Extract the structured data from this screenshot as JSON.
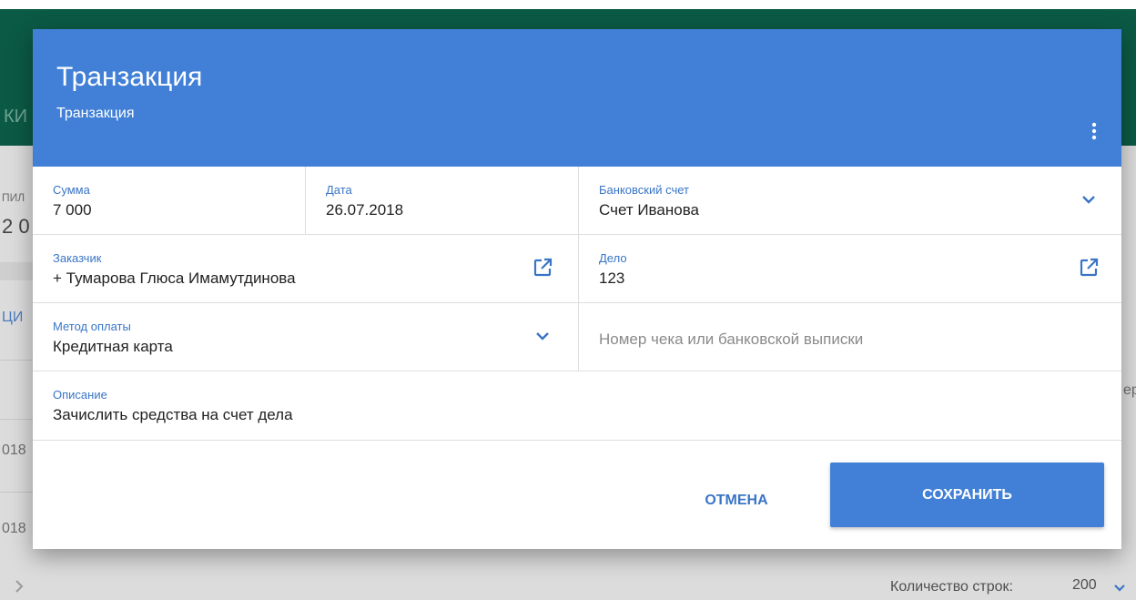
{
  "background": {
    "header_fragment": "КИ",
    "fragments": [
      "ПИЛ",
      "2 0",
      "ЦИ",
      "ер",
      "018",
      "018"
    ],
    "rows_per_page_label": "Количество строк:",
    "rows_per_page_value": "200"
  },
  "dialog": {
    "title": "Транзакция",
    "subtitle": "Транзакция",
    "fields": {
      "amount": {
        "label": "Сумма",
        "value": "7 000"
      },
      "date": {
        "label": "Дата",
        "value": "26.07.2018"
      },
      "bank_account": {
        "label": "Банковский счет",
        "value": "Счет Иванова"
      },
      "customer": {
        "label": "Заказчик",
        "value": "+ Тумарова Глюса Имамутдинова"
      },
      "case": {
        "label": "Дело",
        "value": "123"
      },
      "payment_method": {
        "label": "Метод оплаты",
        "value": "Кредитная карта"
      },
      "check_number": {
        "placeholder": "Номер чека или банковской выписки"
      },
      "description": {
        "label": "Описание",
        "value": "Зачислить средства на счет дела"
      }
    },
    "buttons": {
      "cancel": "ОТМЕНА",
      "save": "СОХРАНИТЬ"
    }
  },
  "colors": {
    "dialog_header": "#4180d6",
    "accent_text": "#3a75c6",
    "app_header": "#0b5a45"
  },
  "icons": [
    "more-vert-icon",
    "chevron-down-icon",
    "open-in-new-icon",
    "chevron-right-icon"
  ]
}
